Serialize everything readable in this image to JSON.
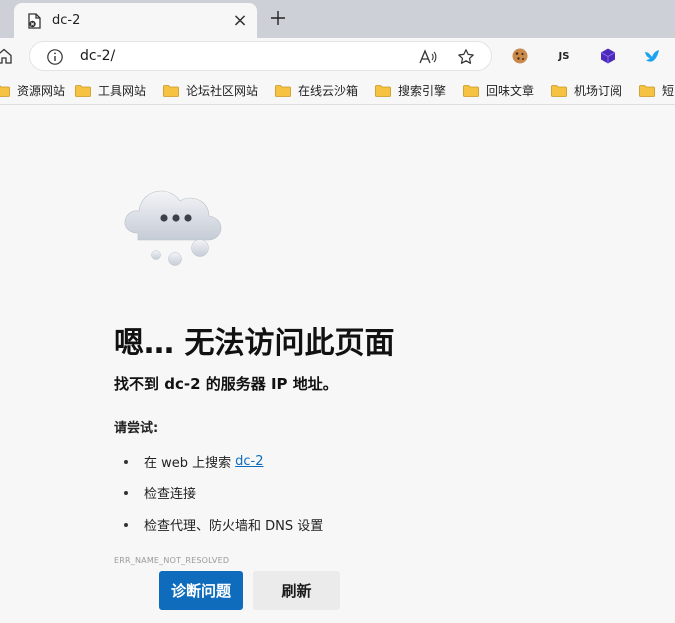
{
  "tab": {
    "title": "dc-2",
    "close_glyph": "×",
    "new_tab_glyph": "+"
  },
  "address_bar": {
    "url": "dc-2/",
    "read_aloud_glyph": "A⁾"
  },
  "extensions": [
    {
      "name": "cookie-extension-icon",
      "label": ""
    },
    {
      "name": "js-extension-icon",
      "label": "JS"
    },
    {
      "name": "purple-cube-extension-icon",
      "label": ""
    },
    {
      "name": "blue-bird-extension-icon",
      "label": ""
    }
  ],
  "bookmarks": [
    {
      "label": "资源网站"
    },
    {
      "label": "工具网站"
    },
    {
      "label": "论坛社区网站"
    },
    {
      "label": "在线云沙箱"
    },
    {
      "label": "搜索引擎"
    },
    {
      "label": "回味文章"
    },
    {
      "label": "机场订阅"
    },
    {
      "label": "短"
    }
  ],
  "error_page": {
    "headline": "嗯… 无法访问此页面",
    "subline": "找不到 dc-2 的服务器 IP 地址。",
    "try_label": "请尝试:",
    "suggestions": {
      "search_prefix": "在 web 上搜索",
      "search_link": "dc-2",
      "check_connection": "检查连接",
      "check_proxy": "检查代理、防火墙和 DNS 设置"
    },
    "error_code": "ERR_NAME_NOT_RESOLVED",
    "diagnose_button": "诊断问题",
    "refresh_button": "刷新"
  },
  "colors": {
    "accent": "#0f6cbd",
    "tabstrip": "#cdd0d6",
    "page_bg": "#f7f7f7",
    "folder": "#f5c242"
  }
}
